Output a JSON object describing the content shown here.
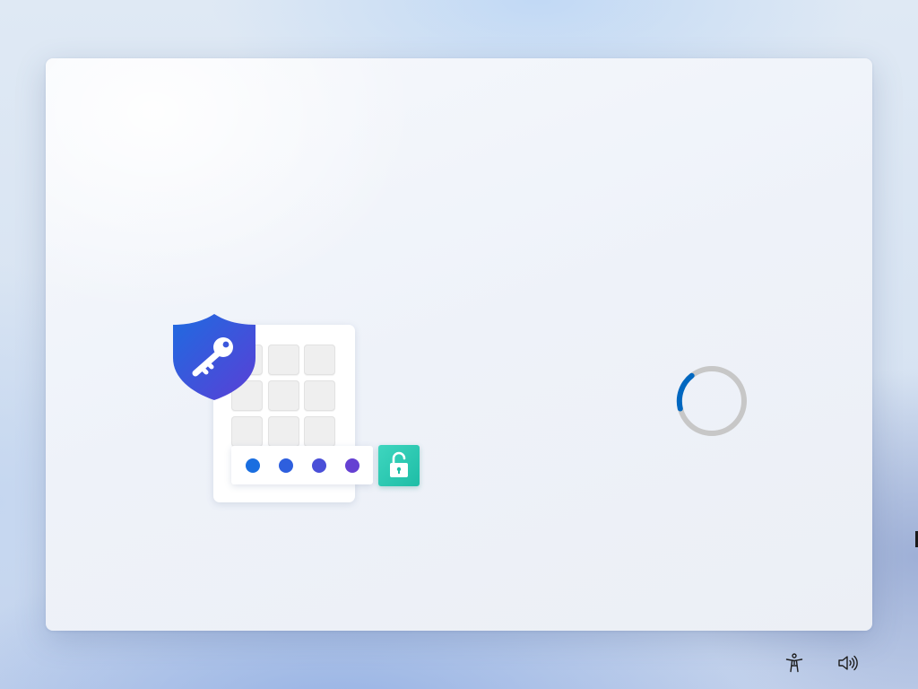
{
  "screen": {
    "state": "loading",
    "accent_color": "#0067c0",
    "spinner_track_color": "#c7c7c7"
  },
  "illustration": {
    "shield_icon": "shield-key-icon",
    "shield_colors": [
      "#1f6be0",
      "#5a3fd6"
    ],
    "unlock_icon": "unlocked-padlock-icon",
    "unlock_color": "#2ccbb3",
    "keypad_keys": 9,
    "pin_dot_count": 4,
    "pin_dot_colors": [
      "#1a6ee0",
      "#2e5fde",
      "#4a4fd8",
      "#6540d2"
    ]
  },
  "taskbar": {
    "accessibility_icon": "accessibility-icon",
    "volume_icon": "volume-icon"
  }
}
